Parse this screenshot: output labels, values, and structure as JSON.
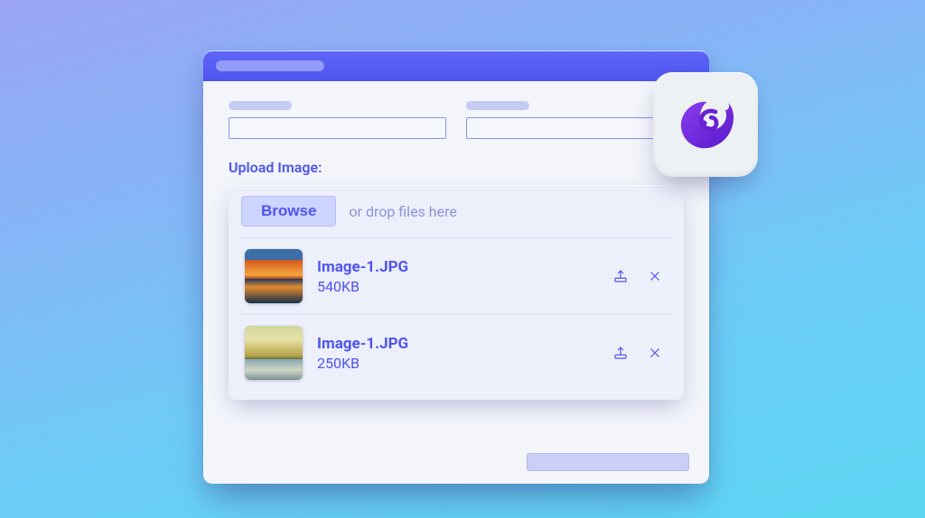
{
  "section_label": "Upload Image:",
  "dropzone": {
    "browse_label": "Browse",
    "hint_text": "or drop files here"
  },
  "files": [
    {
      "name": "Image-1.JPG",
      "size": "540KB"
    },
    {
      "name": "Image-1.JPG",
      "size": "250KB"
    }
  ],
  "app_icon": "blazor-icon"
}
